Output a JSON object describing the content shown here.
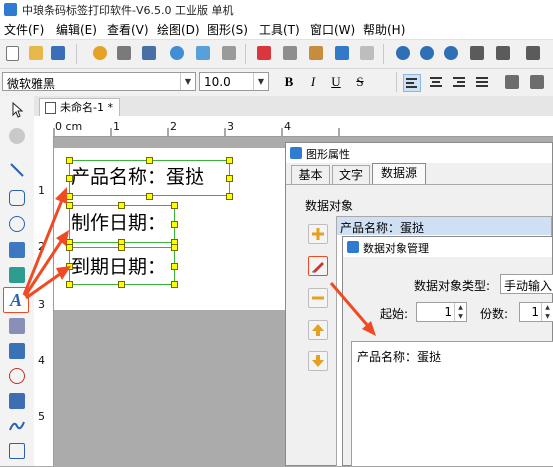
{
  "window": {
    "title": "中琅条码标签打印软件-V6.5.0 工业版 单机"
  },
  "menu": [
    "文件(F)",
    "编辑(E)",
    "查看(V)",
    "绘图(D)",
    "图形(S)",
    "工具(T)",
    "窗口(W)",
    "帮助(H)"
  ],
  "format": {
    "font_name": "微软雅黑",
    "font_size": "10.0",
    "bold": "B",
    "italic": "I",
    "underline": "U",
    "strike": "S"
  },
  "document": {
    "tab_title": "未命名-1 *"
  },
  "ruler": {
    "h_labels": [
      "0 cm",
      "1",
      "2",
      "3",
      "4"
    ],
    "v_labels": [
      "1",
      "2",
      "3",
      "4",
      "5"
    ]
  },
  "label": {
    "lines": [
      "产品名称：蛋挞",
      "制作日期：",
      "到期日期："
    ]
  },
  "prop_dialog": {
    "title": "图形属性",
    "tabs": [
      "基本",
      "文字",
      "数据源"
    ],
    "section": "数据对象",
    "list_item": "产品名称：蛋挞"
  },
  "mgr_dialog": {
    "title": "数据对象管理",
    "type_label": "数据对象类型:",
    "type_value": "手动输入",
    "start_label": "起始:",
    "start_value": "1",
    "copies_label": "份数:",
    "copies_value": "1",
    "content": "产品名称：蛋挞"
  },
  "colors": {
    "accent": "#2e7bd1",
    "selection": "#3bb33b",
    "handle": "#ffff00",
    "annotation": "#f04a24",
    "list_highlight": "#cfe0f5"
  }
}
